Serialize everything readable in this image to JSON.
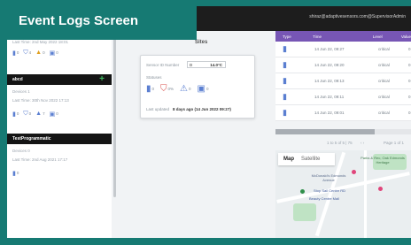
{
  "banner": {
    "title": "Event Logs Screen"
  },
  "topbar": {
    "user_email": "shiraz@adaptivesensors.com@SupervisorAdmin"
  },
  "sidebar": {
    "cards": [
      {
        "title": "",
        "devices": "",
        "last_time": "Last Time: 2nd May 2022 18:01",
        "stats": [
          "0",
          "4",
          "0",
          "0"
        ],
        "show_add": false
      },
      {
        "title": "abcd",
        "devices": "Devices 1",
        "last_time": "Last Time: 30th Nov 2022 17:13",
        "stats": [
          "0",
          "0",
          "7",
          "0"
        ],
        "show_add": true
      },
      {
        "title": "TestProgrammatic",
        "devices": "Devices 0",
        "last_time": "Last Time: 2nd Aug 2021 17:17",
        "stats": [
          "0"
        ],
        "show_add": false
      }
    ]
  },
  "header": {
    "site_name": "Sites"
  },
  "popup": {
    "sensor_id_label": "Sensor ID Number",
    "sensor_id_value": "D",
    "sensor_id_bold": "14.0°C",
    "statuses_label": "Statuses",
    "stats": [
      "0",
      "0%",
      "0",
      "0"
    ],
    "last_updated_label": "Last updated",
    "last_updated_value": "8 days ago (14 Jun 2022 09:27)"
  },
  "table": {
    "columns": [
      "Type",
      "Time",
      "Level",
      "Value"
    ],
    "rows": [
      {
        "time": "14 Jun 22, 09:27",
        "level": "critical",
        "value": "0"
      },
      {
        "time": "14 Jun 22, 09:20",
        "level": "critical",
        "value": "0"
      },
      {
        "time": "14 Jun 22, 09:13",
        "level": "critical",
        "value": "0"
      },
      {
        "time": "14 Jun 22, 09:11",
        "level": "critical",
        "value": "0"
      },
      {
        "time": "14 Jun 22, 09:01",
        "level": "critical",
        "value": "0"
      }
    ]
  },
  "pager": {
    "info": "1 to 5 of 5 | 75",
    "page": "Page 1 of 1"
  },
  "map": {
    "tabs": [
      "Map",
      "Satellite"
    ],
    "labels": [
      "Parks & Rec, Oak Edmonds Heritage",
      "McDonald's Edmonds Avenue",
      "Stop Sail Centre RD",
      "Beauty Centre Mall"
    ]
  },
  "colors": {
    "accent": "#167a73",
    "table_header": "#7756b5",
    "topbar": "#1d1d1d"
  }
}
